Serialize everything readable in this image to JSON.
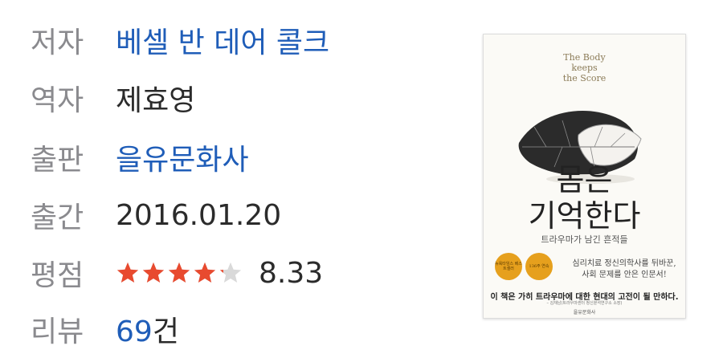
{
  "details": {
    "author_label": "저자",
    "author": "베셀 반 데어 콜크",
    "translator_label": "역자",
    "translator": "제효영",
    "publisher_label": "출판",
    "publisher": "을유문화사",
    "published_label": "출간",
    "published_date": "2016.01.20",
    "rating_label": "평점",
    "rating_score": "8.33",
    "rating_stars": 4.2,
    "review_label": "리뷰",
    "review_count": "69",
    "review_suffix": "건"
  },
  "cover": {
    "en_title_line1": "The Body",
    "en_title_line2": "keeps",
    "en_title_line3": "the Score",
    "title_line1": "몸은",
    "title_line2": "기억한다",
    "subtitle": "트라우마가 남긴 흔적들",
    "badge1": "뉴욕타임스 베스트셀러",
    "badge2": "136주 연속",
    "desc_line1": "심리치료 정신의학사를 뒤바꾼,",
    "desc_line2": "사회 문제를 안은 인문서!",
    "tagline": "이 책은 가히 트라우마에 대한 현대의 고전이 될 만하다.",
    "endorsement": "– 김재남(트라우마센터 정신분석연구소 소장)",
    "publisher_mark": "을유문화사"
  },
  "colors": {
    "label": "#8a8a8e",
    "link": "#1f5db8",
    "star_filled": "#e84a2f",
    "star_empty": "#d9d9d9"
  }
}
